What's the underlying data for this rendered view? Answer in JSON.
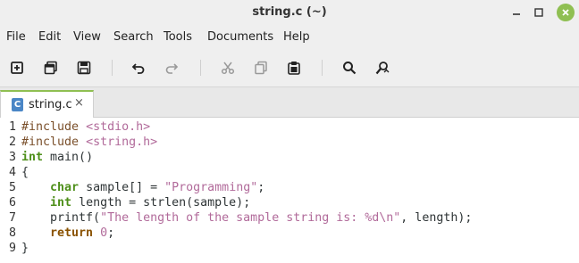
{
  "window": {
    "title": "string.c (~)"
  },
  "menu": [
    "File",
    "Edit",
    "View",
    "Search",
    "Tools",
    "Documents",
    "Help"
  ],
  "toolbar": {
    "icons": [
      "new-document-icon",
      "new-window-icon",
      "save-icon",
      "undo-icon",
      "redo-icon",
      "cut-icon",
      "copy-icon",
      "paste-icon",
      "search-icon",
      "replace-icon"
    ]
  },
  "tab": {
    "icon_letter": "C",
    "label": "string.c",
    "close": "×"
  },
  "editor": {
    "line_numbers": [
      "1",
      "2",
      "3",
      "4",
      "5",
      "6",
      "7",
      "8",
      "9"
    ],
    "lines": [
      "#include <stdio.h>",
      "#include <string.h>",
      "int main()",
      "{",
      "    char sample[] = \"Programming\";",
      "    int length = strlen(sample);",
      "    printf(\"The length of the sample string is: %d\\n\", length);",
      "    return 0;",
      "}"
    ]
  },
  "colors": {
    "accent": "#8fbf52",
    "chrome": "#efefef",
    "string": "#b16a9a",
    "type": "#4e8f1a",
    "keyword": "#8a5200"
  }
}
